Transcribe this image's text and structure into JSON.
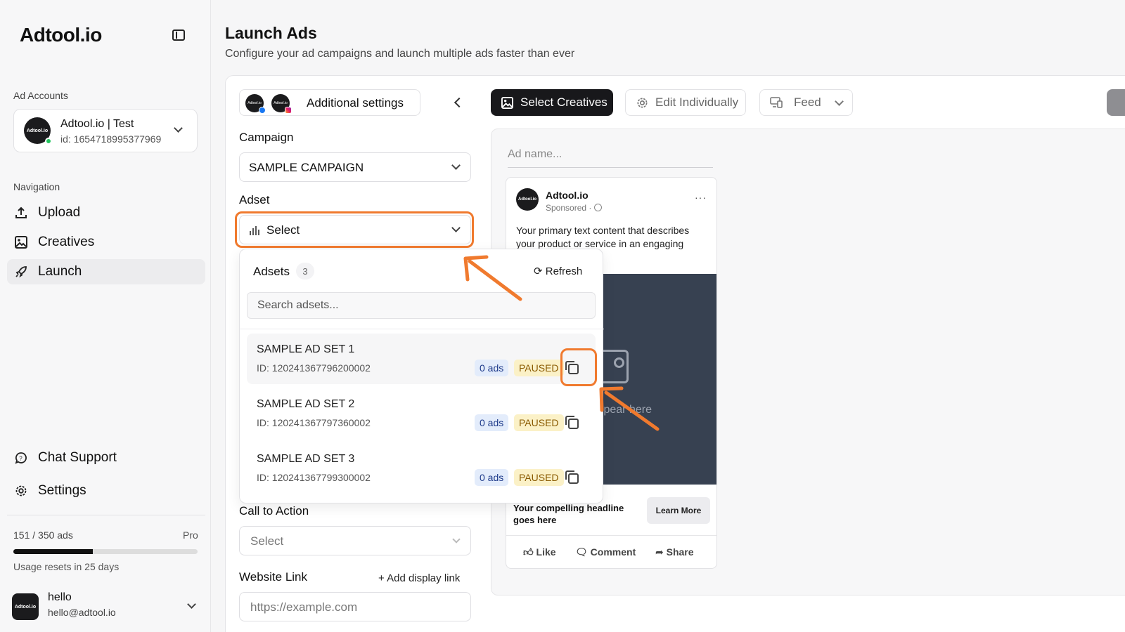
{
  "brand": {
    "logo": "Adtool.io"
  },
  "sidebar": {
    "ad_accounts_label": "Ad Accounts",
    "account": {
      "avatar_text": "Adtool.io",
      "name": "Adtool.io | Test",
      "id": "id: 1654718995377969"
    },
    "navigation_label": "Navigation",
    "nav": [
      {
        "label": "Upload",
        "icon": "upload-icon"
      },
      {
        "label": "Creatives",
        "icon": "image-icon"
      },
      {
        "label": "Launch",
        "icon": "rocket-icon",
        "active": true
      }
    ],
    "bottom_nav": [
      {
        "label": "Chat Support",
        "icon": "chat-icon"
      },
      {
        "label": "Settings",
        "icon": "gear-icon"
      }
    ],
    "usage": {
      "text": "151 / 350 ads",
      "plan": "Pro",
      "fraction": 0.43,
      "reset": "Usage resets in 25 days"
    },
    "user": {
      "avatar_text": "Adtool.io",
      "name": "hello",
      "email": "hello@adtool.io"
    }
  },
  "header": {
    "title": "Launch Ads",
    "subtitle": "Configure your ad campaigns and launch multiple ads faster than ever"
  },
  "form": {
    "settings_label": "Additional settings",
    "avatar_text": "Adtool.io",
    "campaign_label": "Campaign",
    "campaign_value": "SAMPLE CAMPAIGN",
    "adset_label": "Adset",
    "adset_value": "Select",
    "cta_label": "Call to Action",
    "cta_placeholder": "Select",
    "website_label": "Website Link",
    "add_display_link": "+ Add display link",
    "website_placeholder": "https://example.com"
  },
  "dropdown": {
    "title": "Adsets",
    "count": "3",
    "refresh": "Refresh",
    "search_placeholder": "Search adsets...",
    "items": [
      {
        "name": "SAMPLE AD SET 1",
        "id": "ID: 120241367796200002",
        "ads": "0 ads",
        "status": "PAUSED"
      },
      {
        "name": "SAMPLE AD SET 2",
        "id": "ID: 120241367797360002",
        "ads": "0 ads",
        "status": "PAUSED"
      },
      {
        "name": "SAMPLE AD SET 3",
        "id": "ID: 120241367799300002",
        "ads": "0 ads",
        "status": "PAUSED"
      }
    ]
  },
  "toolbar": {
    "select_creatives": "Select Creatives",
    "edit_individually": "Edit Individually",
    "feed": "Feed"
  },
  "preview": {
    "ad_name_placeholder": "Ad name...",
    "page_name": "Adtool.io",
    "avatar_text": "Adtool.io",
    "sponsored": "Sponsored · ",
    "primary_text": "Your primary text content that describes your product or service in an engaging",
    "media_text": "will appear here",
    "headline": "Your compelling headline goes here",
    "cta": "Learn More",
    "actions": [
      "Like",
      "Comment",
      "Share"
    ]
  },
  "colors": {
    "accent_highlight": "#f07a2e",
    "primary_button": "#18181b",
    "online": "#22c55e"
  }
}
